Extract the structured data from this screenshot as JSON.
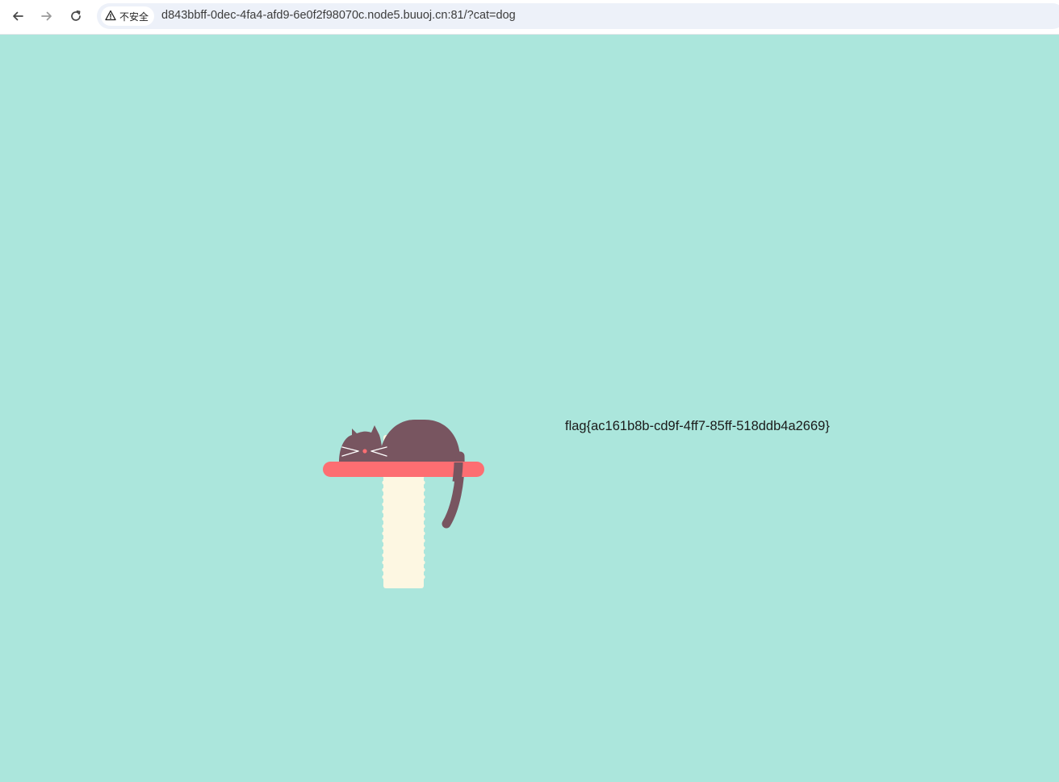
{
  "browser": {
    "security_label": "不安全",
    "url": "d843bbff-0dec-4fa4-afd9-6e0f2f98070c.node5.buuoj.cn:81/?cat=dog",
    "icons": {
      "back": "arrow-left-icon",
      "forward": "arrow-right-icon",
      "reload": "reload-icon",
      "security": "warning-triangle-icon"
    }
  },
  "page": {
    "background_color": "#abe6dc",
    "flag_text": "flag{ac161b8b-cd9f-4ff7-85ff-518ddb4a2669}",
    "illustration": "sleeping-cat-on-scratching-post",
    "colors": {
      "cat": "#785560",
      "perch": "#fd6e72",
      "post": "#fdf7e2",
      "whiskers": "#ffffff",
      "nose": "#fd6e72"
    }
  }
}
